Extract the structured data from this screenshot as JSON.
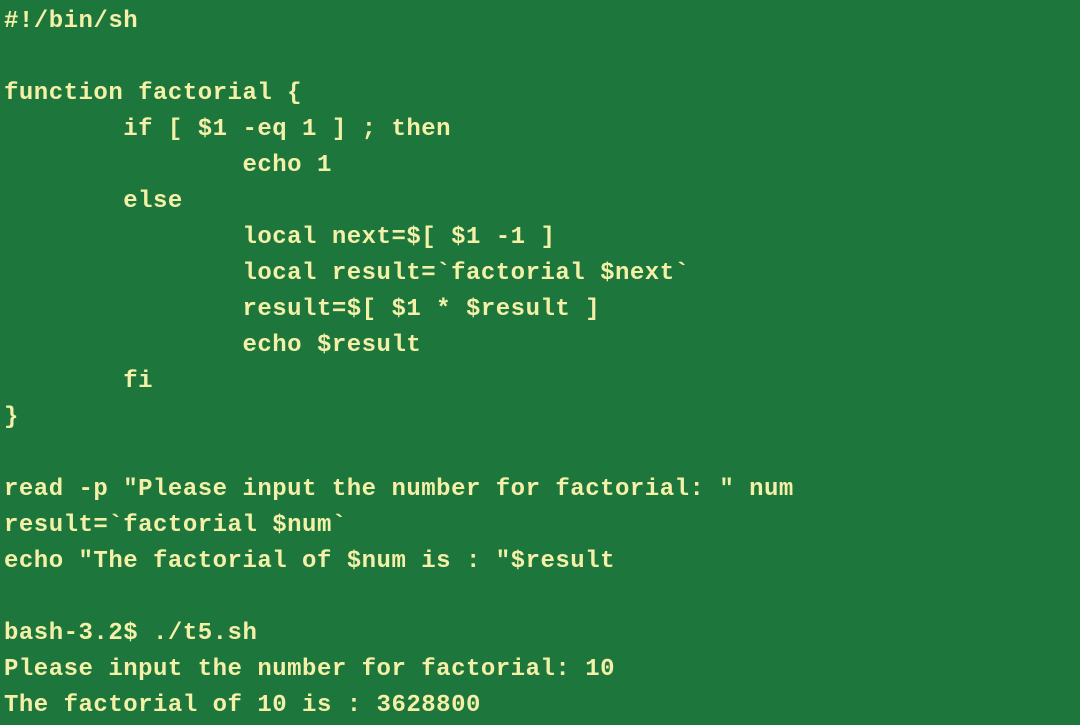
{
  "lines": [
    "#!/bin/sh",
    "",
    "function factorial {",
    "        if [ $1 -eq 1 ] ; then",
    "                echo 1",
    "        else",
    "                local next=$[ $1 -1 ]",
    "                local result=`factorial $next`",
    "                result=$[ $1 * $result ]",
    "                echo $result",
    "        fi",
    "}",
    "",
    "read -p \"Please input the number for factorial: \" num",
    "result=`factorial $num`",
    "echo \"The factorial of $num is : \"$result",
    "",
    "bash-3.2$ ./t5.sh",
    "Please input the number for factorial: 10",
    "The factorial of 10 is : 3628800"
  ]
}
